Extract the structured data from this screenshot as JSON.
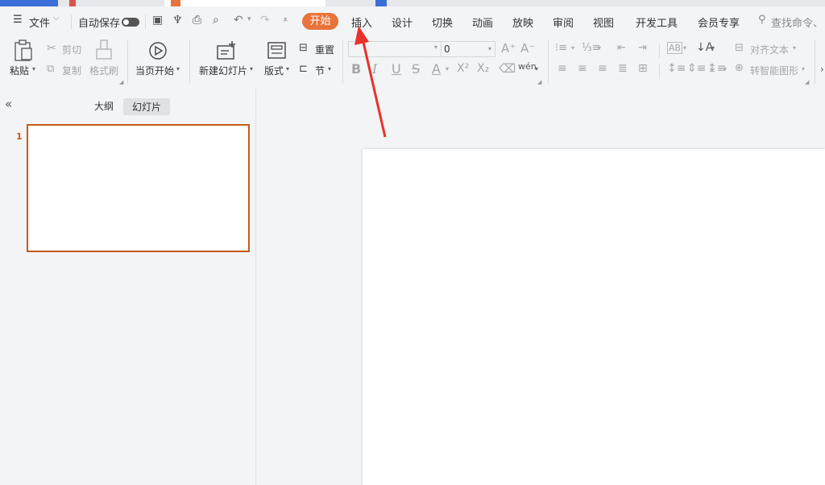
{
  "menu": {
    "file": "文件",
    "autosave": "自动保存",
    "tabs": [
      "开始",
      "插入",
      "设计",
      "切换",
      "动画",
      "放映",
      "审阅",
      "视图",
      "开发工具",
      "会员专享"
    ],
    "active_tab": "开始",
    "search_placeholder": "查找命令、"
  },
  "ribbon": {
    "paste": "粘贴",
    "cut": "剪切",
    "copy": "复制",
    "format_painter": "格式刷",
    "play_from_current": "当页开始",
    "new_slide": "新建幻灯片",
    "layout": "版式",
    "reset": "重置",
    "section": "节",
    "font_name": "",
    "font_size": "0",
    "bold": "B",
    "italic": "I",
    "underline": "U",
    "strike": "S",
    "font_color": "A",
    "superscript": "X²",
    "subscript": "X₂",
    "phonetic": "wén",
    "align_text": "对齐文本",
    "smart_art": "转智能图形",
    "grow_font": "A⁺",
    "shrink_font": "A⁻"
  },
  "panel": {
    "outline_tab": "大纲",
    "slides_tab": "幻灯片",
    "slide_number": "1"
  },
  "colors": {
    "accent": "#e8743b",
    "selection_border": "#c55a11",
    "arrow": "#e8322a"
  }
}
